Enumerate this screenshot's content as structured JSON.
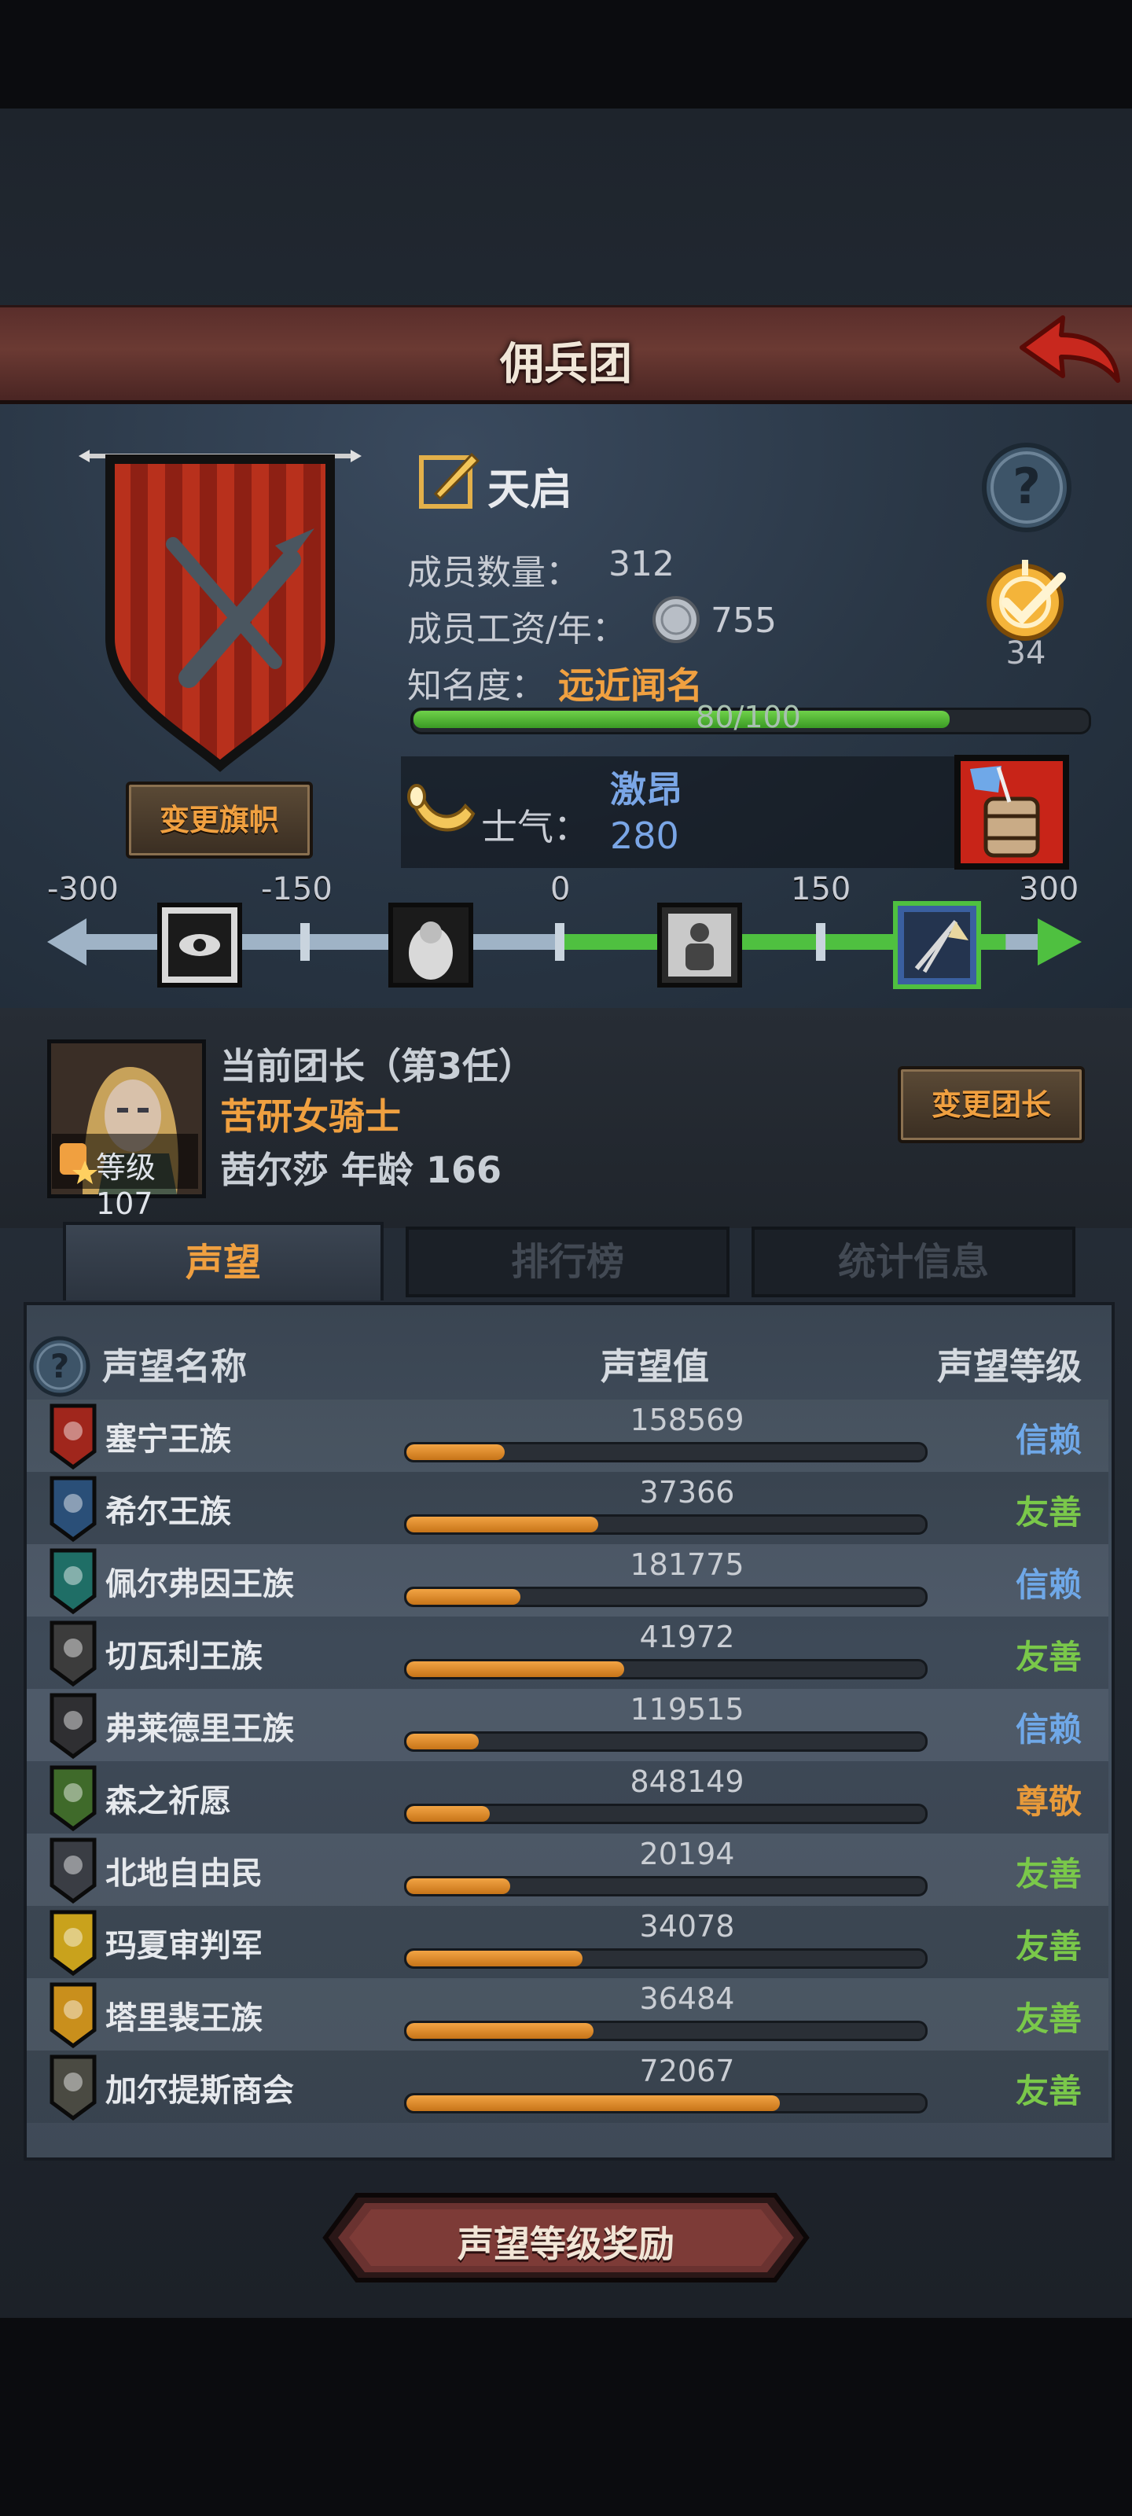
{
  "header": {
    "title": "佣兵团"
  },
  "guild": {
    "name": "天启",
    "members_label": "成员数量：",
    "members": "312",
    "wage_label": "成员工资/年：",
    "wage": "755",
    "fame_label": "知名度：",
    "fame_title": "远近闻名",
    "fame_text": "80/100",
    "fame_progress": 0.8,
    "rank": "34",
    "change_banner_label": "变更旗帜"
  },
  "morale": {
    "label": "士气：",
    "state": "激昂",
    "value": "280",
    "scale_ticks": [
      "-300",
      "-150",
      "0",
      "150",
      "300"
    ],
    "scale_value": 280
  },
  "leader": {
    "heading": "当前团长（第3任）",
    "class": "苦研女骑士",
    "level": "等级107",
    "name_age": "茜尔莎  年龄  166",
    "change_label": "变更团长"
  },
  "tabs": [
    {
      "label": "声望",
      "active": true
    },
    {
      "label": "排行榜",
      "active": false
    },
    {
      "label": "统计信息",
      "active": false
    }
  ],
  "table": {
    "col_name": "声望名称",
    "col_value": "声望值",
    "col_level": "声望等级",
    "rows": [
      {
        "name": "塞宁王族",
        "value": "158569",
        "level": "信赖",
        "progress": 0.19,
        "level_color": "#6fa8e8",
        "icon_color": "#a0261c"
      },
      {
        "name": "希尔王族",
        "value": "37366",
        "level": "友善",
        "progress": 0.37,
        "level_color": "#7ac84a",
        "icon_color": "#2a4f78"
      },
      {
        "name": "佩尔弗因王族",
        "value": "181775",
        "level": "信赖",
        "progress": 0.22,
        "level_color": "#6fa8e8",
        "icon_color": "#1f6e66"
      },
      {
        "name": "切瓦利王族",
        "value": "41972",
        "level": "友善",
        "progress": 0.42,
        "level_color": "#7ac84a",
        "icon_color": "#3c3c3c"
      },
      {
        "name": "弗莱德里王族",
        "value": "119515",
        "level": "信赖",
        "progress": 0.14,
        "level_color": "#6fa8e8",
        "icon_color": "#2f2f32"
      },
      {
        "name": "森之祈愿",
        "value": "848149",
        "level": "尊敬",
        "progress": 0.16,
        "level_color": "#e89a3a",
        "icon_color": "#3f6a2a"
      },
      {
        "name": "北地自由民",
        "value": "20194",
        "level": "友善",
        "progress": 0.2,
        "level_color": "#7ac84a",
        "icon_color": "#3a3d44"
      },
      {
        "name": "玛夏审判军",
        "value": "34078",
        "level": "友善",
        "progress": 0.34,
        "level_color": "#7ac84a",
        "icon_color": "#c9a21c"
      },
      {
        "name": "塔里裴王族",
        "value": "36484",
        "level": "友善",
        "progress": 0.36,
        "level_color": "#7ac84a",
        "icon_color": "#c98f1c"
      },
      {
        "name": "加尔提斯商会",
        "value": "72067",
        "level": "友善",
        "progress": 0.72,
        "level_color": "#7ac84a",
        "icon_color": "#4a4a42"
      }
    ]
  },
  "reward_button": "声望等级奖励"
}
